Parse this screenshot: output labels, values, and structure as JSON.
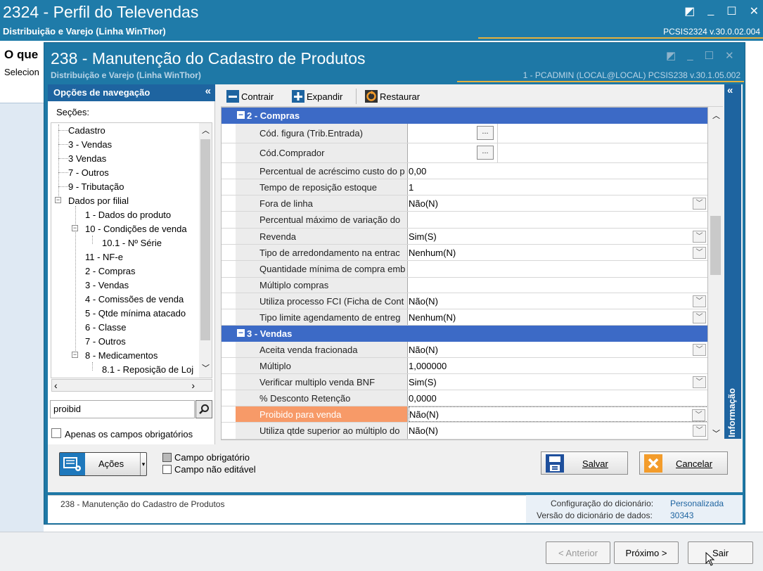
{
  "outer": {
    "title": "2324 - Perfil do Televendas",
    "subtitle": "Distribuição e Varejo (Linha WinThor)",
    "version": "PCSIS2324  v.30.0.02.004",
    "heading": "O que",
    "subheading": "Selecion",
    "btn_anterior": "< Anterior",
    "btn_proximo": "Próximo >",
    "btn_sair": "Sair"
  },
  "inner": {
    "title": "238 - Manutenção do Cadastro de Produtos",
    "subtitle": "Distribuição e Varejo (Linha WinThor)",
    "version": "1 - PCADMIN (LOCAL@LOCAL)   PCSIS238  v.30.1.05.002"
  },
  "nav": {
    "header": "Opções de navegação",
    "collapse_glyph": "«",
    "sections_label": "Seções:",
    "tree": [
      "Cadastro",
      "3 - Vendas",
      "3 Vendas",
      "7 - Outros",
      "9 - Tributação",
      "Dados por filial",
      "1 - Dados do produto",
      "10 - Condições de venda",
      "10.1 - Nº Série",
      "11 - NF-e",
      "2 - Compras",
      "3 - Vendas",
      "4 - Comissões de venda",
      "5 - Qtde mínima atacado",
      "6 - Classe",
      "7 - Outros",
      "8 - Medicamentos",
      "8.1 - Reposição de Loj"
    ],
    "search_value": "proibid",
    "only_required_label": "Apenas os campos obrigatórios"
  },
  "toolbar": {
    "contrair": "Contrair",
    "expandir": "Expandir",
    "restaurar": "Restaurar"
  },
  "grid": {
    "section_compras": "2 - Compras",
    "section_vendas": "3 - Vendas",
    "compras_rows": [
      {
        "label": "Cód. figura (Trib.Entrada)",
        "value": ""
      },
      {
        "label": "Cód.Comprador",
        "value": ""
      },
      {
        "label": "Percentual de acréscimo custo do p",
        "value": "0,00"
      },
      {
        "label": "Tempo de reposição estoque",
        "value": "1"
      },
      {
        "label": "Fora de linha",
        "value": "Não(N)"
      },
      {
        "label": "Percentual máximo de variação do",
        "value": ""
      },
      {
        "label": "Revenda",
        "value": "Sim(S)"
      },
      {
        "label": "Tipo de arredondamento na entrac",
        "value": "Nenhum(N)"
      },
      {
        "label": "Quantidade mínima de compra emb",
        "value": ""
      },
      {
        "label": "Múltiplo compras",
        "value": ""
      },
      {
        "label": "Utiliza processo FCI (Ficha de Cont",
        "value": "Não(N)"
      },
      {
        "label": "Tipo limite agendamento de entreg",
        "value": "Nenhum(N)"
      }
    ],
    "vendas_rows": [
      {
        "label": "Aceita venda fracionada",
        "value": "Não(N)"
      },
      {
        "label": "Múltiplo",
        "value": "1,000000"
      },
      {
        "label": "Verificar multiplo venda BNF",
        "value": "Sim(S)"
      },
      {
        "label": "% Desconto Retenção",
        "value": "0,0000"
      },
      {
        "label": "Proibido para venda",
        "value": "Não(N)"
      },
      {
        "label": "Utiliza qtde superior ao múltiplo do",
        "value": "Não(N)"
      }
    ]
  },
  "info_label": "Informação",
  "actions": {
    "acoes": "Ações",
    "legend_required": "Campo obrigatório",
    "legend_readonly": "Campo não editável",
    "salvar": "Salvar",
    "cancelar": "Cancelar"
  },
  "status": {
    "left": "238 - Manutenção do Cadastro de Produtos",
    "dict_config_label": "Configuração do dicionário:",
    "dict_config_value": "Personalizada",
    "dict_version_label": "Versão do dicionário de dados:",
    "dict_version_value": "30343"
  },
  "colors": {
    "title_bar": "#1f7ba9",
    "section_header": "#3c6ac6",
    "highlight_row": "#f79a68",
    "accent_line": "#e6b13c"
  }
}
